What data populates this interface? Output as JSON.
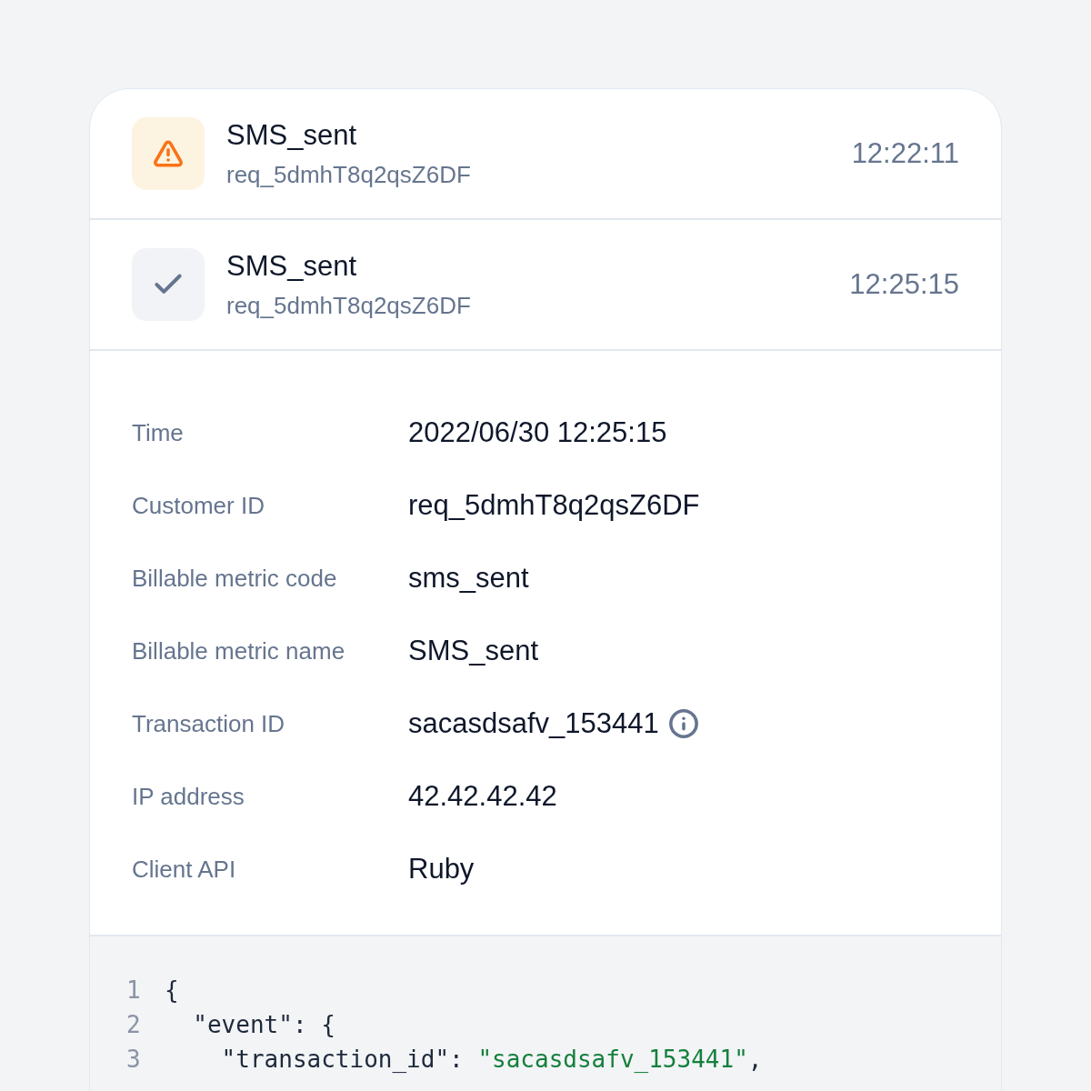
{
  "events": [
    {
      "kind": "warning",
      "title": "SMS_sent",
      "request_id": "req_5dmhT8q2qsZ6DF",
      "time": "12:22:11"
    },
    {
      "kind": "success",
      "title": "SMS_sent",
      "request_id": "req_5dmhT8q2qsZ6DF",
      "time": "12:25:15"
    }
  ],
  "details": [
    {
      "label": "Time",
      "value": "2022/06/30 12:25:15",
      "info": false
    },
    {
      "label": "Customer ID",
      "value": "req_5dmhT8q2qsZ6DF",
      "info": false
    },
    {
      "label": "Billable metric code",
      "value": "sms_sent",
      "info": false
    },
    {
      "label": "Billable metric name",
      "value": "SMS_sent",
      "info": false
    },
    {
      "label": "Transaction ID",
      "value": "sacasdsafv_153441",
      "info": true
    },
    {
      "label": "IP address",
      "value": "42.42.42.42",
      "info": false
    },
    {
      "label": "Client API",
      "value": "Ruby",
      "info": false
    }
  ],
  "code": [
    {
      "number": "1",
      "segments": [
        {
          "kind": "plain",
          "text": "{"
        }
      ]
    },
    {
      "number": "2",
      "segments": [
        {
          "kind": "plain",
          "text": "  \"event\": {"
        }
      ]
    },
    {
      "number": "3",
      "segments": [
        {
          "kind": "plain",
          "text": "    \"transaction_id\": "
        },
        {
          "kind": "string",
          "text": "\"sacasdsafv_153441\""
        },
        {
          "kind": "plain",
          "text": ","
        }
      ]
    }
  ]
}
